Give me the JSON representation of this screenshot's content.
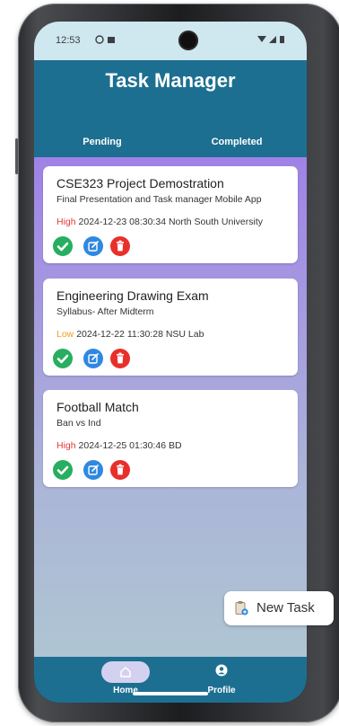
{
  "status_bar": {
    "time": "12:53"
  },
  "app": {
    "title": "Task Manager"
  },
  "tabs": [
    {
      "label": "Pending"
    },
    {
      "label": "Completed"
    }
  ],
  "tasks": [
    {
      "title": "CSE323 Project Demostration",
      "description": "Final Presentation and Task manager Mobile App",
      "priority": "High",
      "datetime": "2024-12-23 08:30:34",
      "location": "North South University"
    },
    {
      "title": "Engineering Drawing Exam",
      "description": "Syllabus- After Midterm",
      "priority": "Low",
      "datetime": "2024-12-22 11:30:28",
      "location": "NSU Lab"
    },
    {
      "title": "Football Match",
      "description": "Ban vs Ind",
      "priority": "High",
      "datetime": "2024-12-25 01:30:46",
      "location": "BD"
    }
  ],
  "fab": {
    "label": "New Task",
    "icon": "clipboard-icon"
  },
  "bottom_nav": [
    {
      "label": "Home",
      "icon": "home-icon",
      "active": true
    },
    {
      "label": "Profile",
      "icon": "profile-icon",
      "active": false
    }
  ],
  "colors": {
    "primary": "#1d6f91",
    "high_priority": "#e53935",
    "low_priority": "#f39c12",
    "complete": "#27ae60",
    "edit": "#2f88e0",
    "delete": "#e8302b"
  }
}
